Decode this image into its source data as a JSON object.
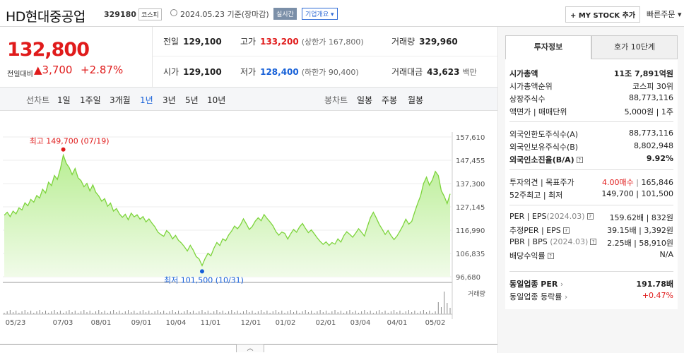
{
  "header": {
    "name": "HD현대중공업",
    "code": "329180",
    "market": "코스피",
    "date": "2024.05.23  기준(장마감)",
    "realtime": "실시간",
    "overview": "기업개요 ▾",
    "mystock": "+ MY STOCK 추가",
    "quick": "빠른주문 ▾"
  },
  "price": {
    "current": "132,800",
    "change_label": "전일대비",
    "change": "▲3,700",
    "change_pct": "+2.87%"
  },
  "metrics": {
    "prev_label": "전일",
    "prev": "129,100",
    "high_label": "고가",
    "high": "133,200",
    "high_limit": "(상한가 167,800)",
    "volume_label": "거래량",
    "volume": "329,960",
    "open_label": "시가",
    "open": "129,100",
    "low_label": "저가",
    "low": "128,400",
    "low_limit": "(하한가 90,400)",
    "amount_label": "거래대금",
    "amount": "43,623",
    "amount_unit": "백만"
  },
  "tabs": {
    "line_label": "선차트",
    "line_items": [
      "1일",
      "1주일",
      "3개월",
      "1년",
      "3년",
      "5년",
      "10년"
    ],
    "candle_label": "봉차트",
    "candle_items": [
      "일봉",
      "주봉",
      "월봉"
    ]
  },
  "chart_data": {
    "type": "area",
    "yticks": [
      "157,610",
      "147,455",
      "137,300",
      "127,145",
      "116,990",
      "106,835",
      "96,680"
    ],
    "ylim": [
      96680,
      157610
    ],
    "xticks": [
      "05/23",
      "07/03",
      "08/01",
      "09/01",
      "10/04",
      "11/01",
      "12/01",
      "01/02",
      "02/01",
      "03/04",
      "04/01",
      "05/02"
    ],
    "high_label": "최고 149,700 (07/19)",
    "low_label": "최저 101,500 (10/31)",
    "volume_legend": "거래량",
    "values": [
      123500,
      124800,
      122900,
      125300,
      124100,
      126700,
      125800,
      128900,
      127600,
      130400,
      129200,
      132100,
      131000,
      134800,
      133200,
      137900,
      136400,
      140800,
      139100,
      143700,
      149700,
      146100,
      144300,
      141200,
      143900,
      139800,
      138600,
      135900,
      137400,
      134100,
      136700,
      133500,
      131900,
      129600,
      130700,
      127400,
      128800,
      125300,
      126400,
      124100,
      122600,
      123900,
      121500,
      124400,
      122800,
      123700,
      121800,
      122900,
      120600,
      121900,
      120100,
      118500,
      116200,
      115100,
      114300,
      116800,
      115600,
      113200,
      114700,
      112600,
      111400,
      109800,
      107900,
      110400,
      108300,
      105500,
      104400,
      101500,
      104600,
      106900,
      105800,
      109100,
      111600,
      110300,
      113200,
      112400,
      114900,
      116600,
      118800,
      117600,
      119300,
      121900,
      119700,
      117300,
      118600,
      120900,
      122400,
      121100,
      123800,
      122100,
      120600,
      118900,
      116300,
      114800,
      116200,
      115600,
      113100,
      115400,
      117300,
      116100,
      118400,
      119900,
      117800,
      115900,
      117100,
      115400,
      113600,
      112100,
      110800,
      111900,
      110300,
      111600,
      110900,
      113200,
      111800,
      114600,
      116300,
      115200,
      113900,
      115700,
      117600,
      116100,
      114400,
      118600,
      122400,
      124800,
      122300,
      119500,
      117400,
      115100,
      116800,
      114600,
      112900,
      114400,
      116600,
      118900,
      121800,
      119600,
      120800,
      124900,
      128600,
      131900,
      137300,
      140100,
      136600,
      138900,
      142600,
      140800,
      134200,
      131800,
      128600,
      132800
    ]
  }
}
